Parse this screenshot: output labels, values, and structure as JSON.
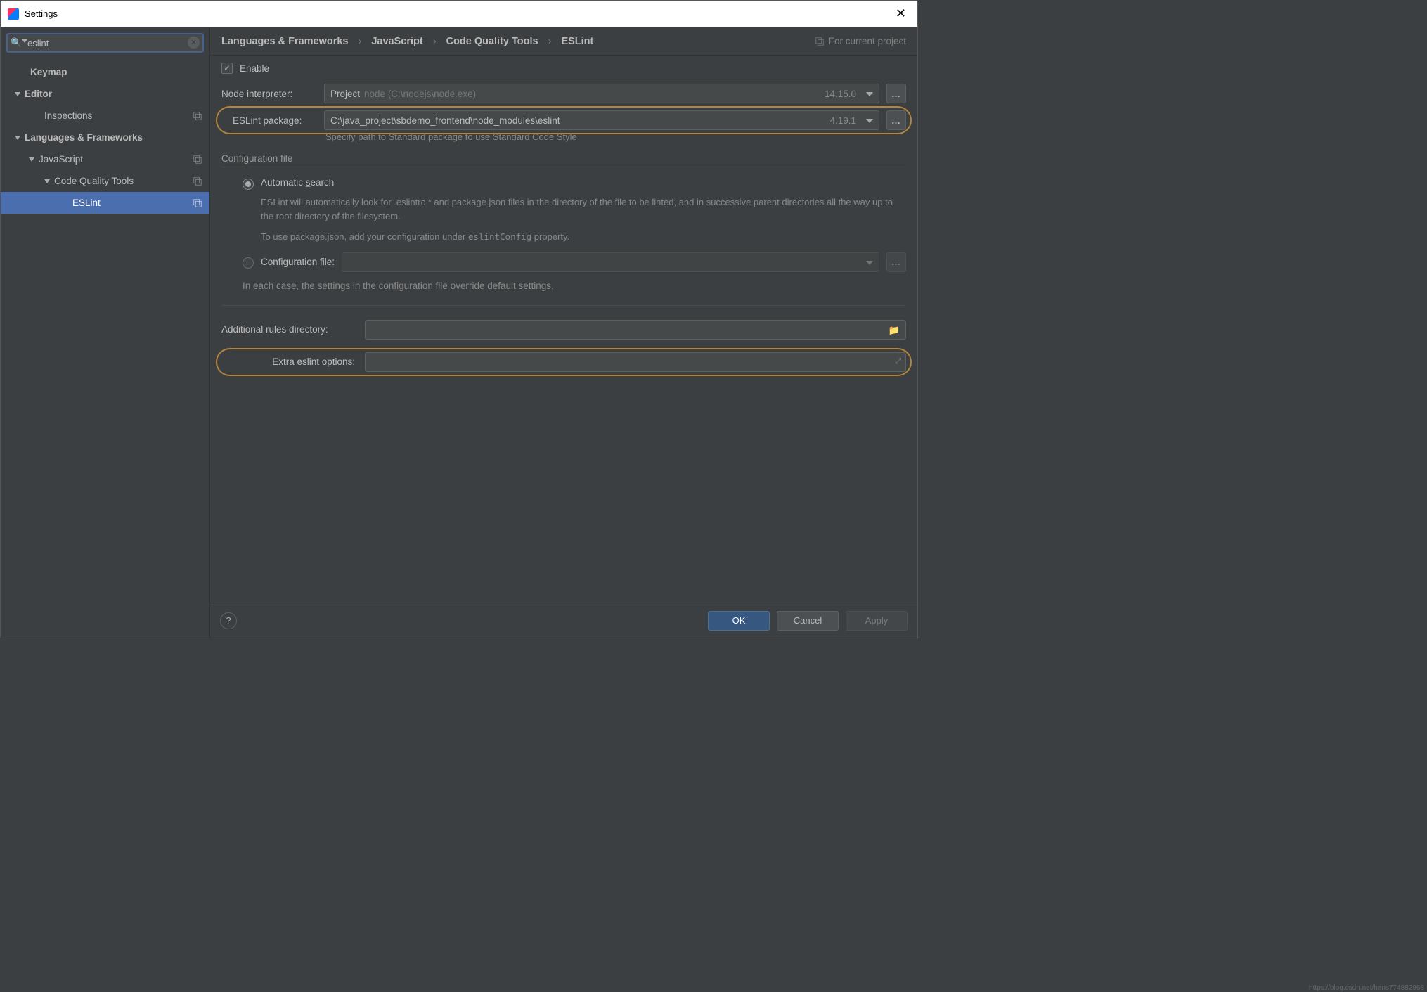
{
  "window": {
    "title": "Settings"
  },
  "search": {
    "value": "eslint"
  },
  "tree": {
    "keymap": "Keymap",
    "editor": "Editor",
    "inspections": "Inspections",
    "langfw": "Languages & Frameworks",
    "javascript": "JavaScript",
    "cqt": "Code Quality Tools",
    "eslint": "ESLint"
  },
  "breadcrumb": {
    "a": "Languages & Frameworks",
    "b": "JavaScript",
    "c": "Code Quality Tools",
    "d": "ESLint",
    "badge": "For current project"
  },
  "form": {
    "enable": "Enable",
    "node_label": "Node interpreter:",
    "node_project": "Project",
    "node_path": "node (C:\\nodejs\\node.exe)",
    "node_version": "14.15.0",
    "eslint_label": "ESLint package:",
    "eslint_path": "C:\\java_project\\sbdemo_frontend\\node_modules\\eslint",
    "eslint_version": "4.19.1",
    "hint": "Specify path to Standard package to use Standard Code Style",
    "config_title": "Configuration file",
    "auto_pre": "Automatic ",
    "auto_u": "s",
    "auto_post": "earch",
    "auto_desc1": "ESLint will automatically look for .eslintrc.* and package.json files in the directory of the file to be linted, and in successive parent directories all the way up to the root directory of the filesystem.",
    "auto_desc2a": "To use package.json, add your configuration under ",
    "auto_desc2b": "eslintConfig",
    "auto_desc2c": " property.",
    "cfg_u": "C",
    "cfg_post": "onfiguration file:",
    "note": "In each case, the settings in the configuration file override default settings.",
    "rules_label": "Additional rules directory:",
    "extra_label": "Extra eslint options:"
  },
  "buttons": {
    "ok": "OK",
    "cancel": "Cancel",
    "apply": "Apply"
  },
  "watermark": "https://blog.csdn.net/hans774882968"
}
